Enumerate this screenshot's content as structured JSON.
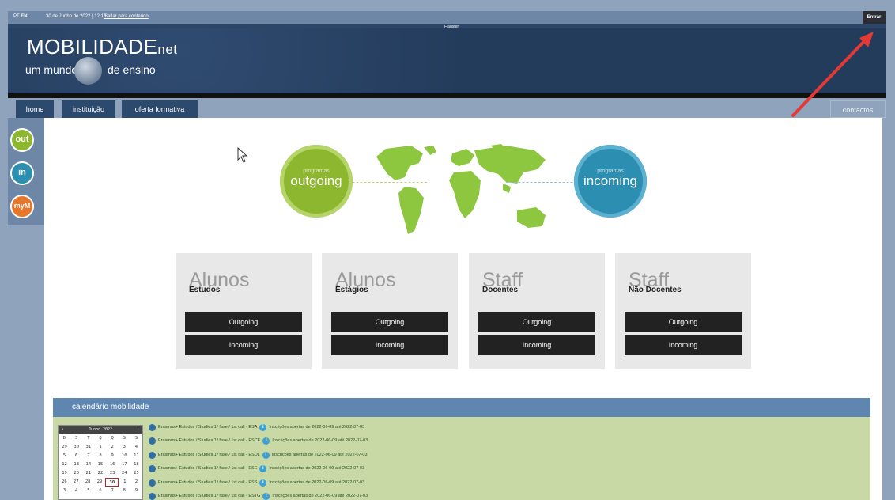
{
  "topbar": {
    "lang_pt": "PT",
    "lang_en": "EN",
    "datetime": "30 de Junho de 2022 | 12:13",
    "skip_link": "Saltar para conteúdo",
    "login": "Entrar"
  },
  "header": {
    "flag_text": "Flagster",
    "brand_main": "MOBILIDADE",
    "brand_suffix": "net",
    "tagline_left": "um mundo",
    "tagline_right": "de ensino"
  },
  "nav": {
    "home": "home",
    "instituicao": "instituição",
    "oferta": "oferta formativa",
    "contactos": "contactos"
  },
  "side": {
    "out": "out",
    "in": "in",
    "mym": "myM"
  },
  "hero": {
    "outgoing": {
      "sub": "programas",
      "label": "outgoing",
      "color": "#8db72f"
    },
    "incoming": {
      "sub": "programas",
      "label": "incoming",
      "color": "#2c8fb1"
    }
  },
  "cards": [
    {
      "title": "Alunos",
      "subtitle": "Estudos",
      "btn1": "Outgoing",
      "btn2": "Incoming"
    },
    {
      "title": "Alunos",
      "subtitle": "Estágios",
      "btn1": "Outgoing",
      "btn2": "Incoming"
    },
    {
      "title": "Staff",
      "subtitle": "Docentes",
      "btn1": "Outgoing",
      "btn2": "Incoming"
    },
    {
      "title": "Staff",
      "subtitle": "Não Docentes",
      "btn1": "Outgoing",
      "btn2": "Incoming"
    }
  ],
  "calendar": {
    "title": "calendário mobilidade",
    "month": "Junho 2022",
    "prev": "‹",
    "next": "›",
    "weekdays": [
      "D",
      "S",
      "T",
      "Q",
      "Q",
      "S",
      "S"
    ],
    "weeks": [
      [
        "29",
        "30",
        "31",
        "1",
        "2",
        "3",
        "4"
      ],
      [
        "5",
        "6",
        "7",
        "8",
        "9",
        "10",
        "11"
      ],
      [
        "12",
        "13",
        "14",
        "15",
        "16",
        "17",
        "18"
      ],
      [
        "19",
        "20",
        "21",
        "22",
        "23",
        "24",
        "25"
      ],
      [
        "26",
        "27",
        "28",
        "29",
        "30",
        "1",
        "2"
      ],
      [
        "3",
        "4",
        "5",
        "6",
        "7",
        "8",
        "9"
      ]
    ],
    "selected_day": "30",
    "events": [
      {
        "text": "Erasmus+ Estudos / Studies 1ª fase / 1st call - ESA",
        "note": "Inscrições abertas de 2022-06-09 até 2022-07-03"
      },
      {
        "text": "Erasmus+ Estudos / Studies 1ª fase / 1st call - ESCE",
        "note": "Inscrições abertas de 2022-06-09 até 2022-07-03"
      },
      {
        "text": "Erasmus+ Estudos / Studies 1ª fase / 1st call - ESDL",
        "note": "Inscrições abertas de 2022-06-09 até 2022-07-03"
      },
      {
        "text": "Erasmus+ Estudos / Studies 1ª fase / 1st call - ESE",
        "note": "Inscrições abertas de 2022-06-09 até 2022-07-03"
      },
      {
        "text": "Erasmus+ Estudos / Studies 1ª fase / 1st call - ESS",
        "note": "Inscrições abertas de 2022-06-09 até 2022-07-03"
      },
      {
        "text": "Erasmus+ Estudos / Studies 1ª fase / 1st call - ESTG",
        "note": "Inscrições abertas de 2022-06-09 até 2022-07-03"
      }
    ]
  }
}
